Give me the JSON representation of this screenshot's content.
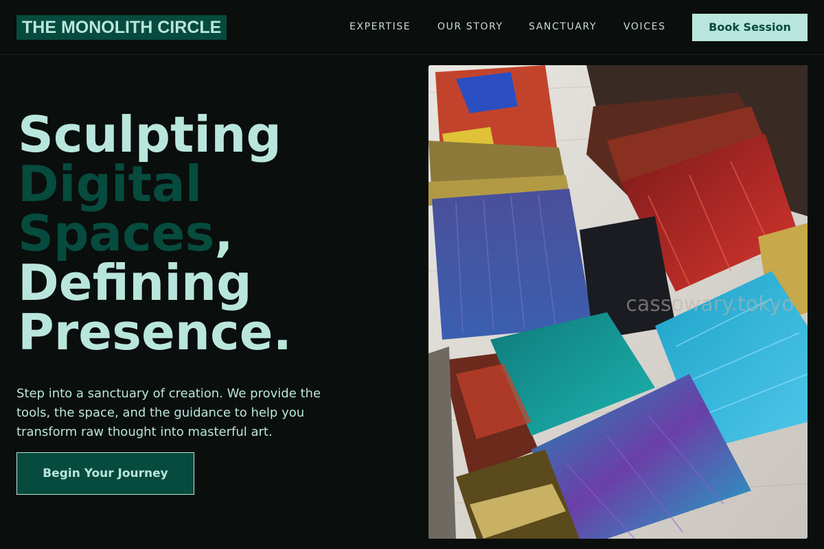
{
  "header": {
    "logo": "THE MONOLITH CIRCLE",
    "nav": [
      "EXPERTISE",
      "OUR STORY",
      "SANCTUARY",
      "VOICES"
    ],
    "cta": "Book Session"
  },
  "hero": {
    "line1": "Sculpting",
    "line2": "Digital",
    "line3": "Spaces",
    "line3_suffix": ",",
    "line4": "Defining",
    "line5": "Presence.",
    "description": "Step into a sanctuary of creation. We provide the tools, the space, and the guidance to help you transform raw thought into masterful art.",
    "cta": "Begin Your Journey"
  },
  "image": {
    "subject": "paint-brushes-photo",
    "watermark": "cassowary.tokyo"
  },
  "colors": {
    "background": "#0a0e0d",
    "accent_dark": "#064b3e",
    "accent_light": "#b9e6dc"
  }
}
